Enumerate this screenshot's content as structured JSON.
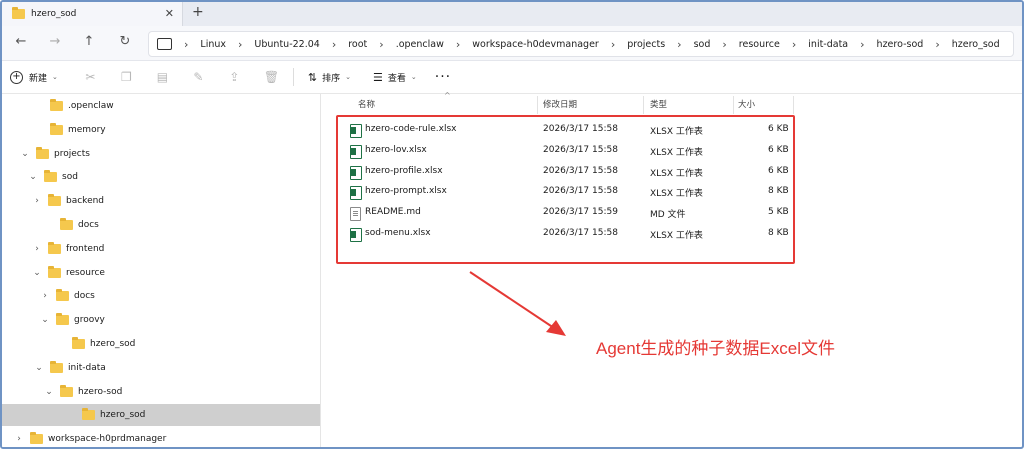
{
  "tab": {
    "title": "hzero_sod"
  },
  "breadcrumb": [
    "Linux",
    "Ubuntu-22.04",
    "root",
    ".openclaw",
    "workspace-h0devmanager",
    "projects",
    "sod",
    "resource",
    "init-data",
    "hzero-sod",
    "hzero_sod"
  ],
  "toolbar": {
    "new_label": "新建",
    "sort_label": "排序",
    "view_label": "查看"
  },
  "navpane": [
    {
      "label": ".openclaw",
      "chevron": ""
    },
    {
      "label": "memory",
      "chevron": ""
    },
    {
      "label": "projects",
      "chevron": "⌄"
    },
    {
      "label": "sod",
      "chevron": "⌄"
    },
    {
      "label": "backend",
      "chevron": "›"
    },
    {
      "label": "docs",
      "chevron": ""
    },
    {
      "label": "frontend",
      "chevron": "›"
    },
    {
      "label": "resource",
      "chevron": "⌄"
    },
    {
      "label": "docs",
      "chevron": "›"
    },
    {
      "label": "groovy",
      "chevron": "⌄"
    },
    {
      "label": "hzero_sod",
      "chevron": ""
    },
    {
      "label": "init-data",
      "chevron": "⌄"
    },
    {
      "label": "hzero-sod",
      "chevron": "⌄"
    },
    {
      "label": "hzero_sod",
      "chevron": "",
      "selected": true
    },
    {
      "label": "workspace-h0prdmanager",
      "chevron": "›"
    }
  ],
  "columns": {
    "name": "名称",
    "modified": "修改日期",
    "type": "类型",
    "size": "大小"
  },
  "files": [
    {
      "name": "hzero-code-rule.xlsx",
      "modified": "2026/3/17 15:58",
      "type": "XLSX 工作表",
      "size": "6 KB",
      "icon": "excel-icon"
    },
    {
      "name": "hzero-lov.xlsx",
      "modified": "2026/3/17 15:58",
      "type": "XLSX 工作表",
      "size": "6 KB",
      "icon": "excel-icon"
    },
    {
      "name": "hzero-profile.xlsx",
      "modified": "2026/3/17 15:58",
      "type": "XLSX 工作表",
      "size": "6 KB",
      "icon": "excel-icon"
    },
    {
      "name": "hzero-prompt.xlsx",
      "modified": "2026/3/17 15:58",
      "type": "XLSX 工作表",
      "size": "8 KB",
      "icon": "excel-icon"
    },
    {
      "name": "README.md",
      "modified": "2026/3/17 15:59",
      "type": "MD 文件",
      "size": "5 KB",
      "icon": "markdown-file-icon"
    },
    {
      "name": "sod-menu.xlsx",
      "modified": "2026/3/17 15:58",
      "type": "XLSX 工作表",
      "size": "8 KB",
      "icon": "excel-icon"
    }
  ],
  "annotation": {
    "text": "Agent生成的种子数据Excel文件",
    "color": "#e53935"
  },
  "colors": {
    "accent_border": "#6f93c4",
    "folder": "#f5c84d",
    "excel": "#1e7145",
    "selected_row": "#cfcfcf"
  }
}
